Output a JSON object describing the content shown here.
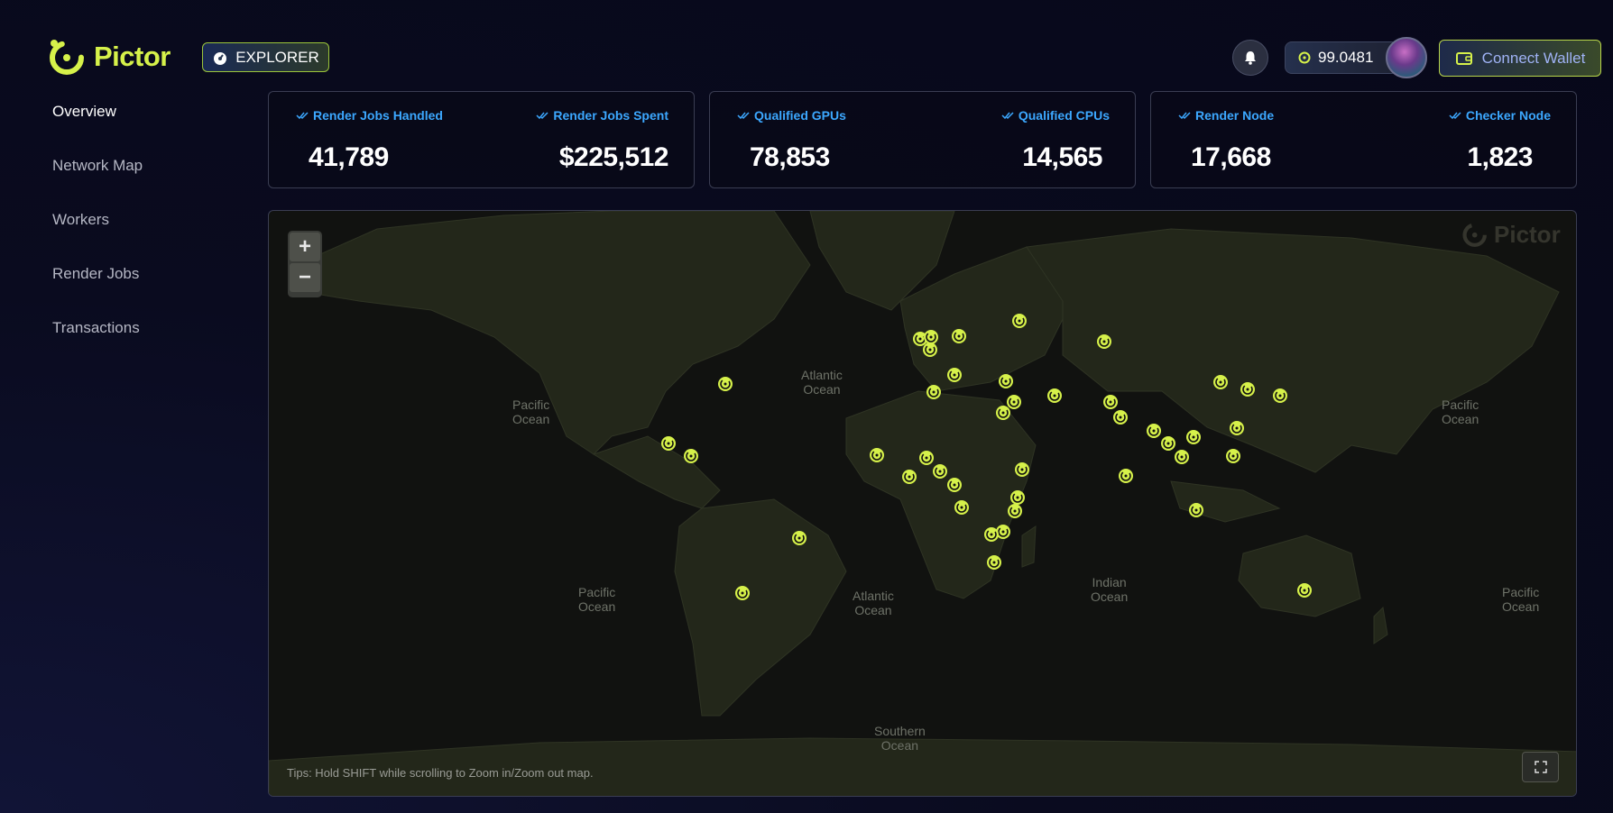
{
  "brand": {
    "name": "Pictor",
    "logo_icon": "pictor-logo-icon",
    "accent": "#d6f14a"
  },
  "header": {
    "explorer_label": "EXPLORER",
    "balance": "99.0481",
    "connect_label": "Connect Wallet"
  },
  "nav": {
    "items": [
      {
        "label": "Overview",
        "active": true
      },
      {
        "label": "Network Map",
        "active": false
      },
      {
        "label": "Workers",
        "active": false
      },
      {
        "label": "Render Jobs",
        "active": false
      },
      {
        "label": "Transactions",
        "active": false
      }
    ]
  },
  "stats": [
    {
      "left_label": "Render Jobs Handled",
      "left_value": "41,789",
      "right_label": "Render Jobs Spent",
      "right_value": "$225,512"
    },
    {
      "left_label": "Qualified GPUs",
      "left_value": "78,853",
      "right_label": "Qualified CPUs",
      "right_value": "14,565"
    },
    {
      "left_label": "Render Node",
      "left_value": "17,668",
      "right_label": "Checker Node",
      "right_value": "1,823"
    }
  ],
  "map": {
    "zoom_in": "+",
    "zoom_out": "−",
    "watermark": "Pictor",
    "oceans": [
      "Pacific\nOcean",
      "Atlantic\nOcean",
      "Pacific\nOcean",
      "Atlantic\nOcean",
      "Indian\nOcean",
      "Pacific\nOcean",
      "Pacific\nOcean",
      "Southern\nOcean"
    ],
    "tips": "Tips: Hold SHIFT while scrolling to Zoom in/Zoom out map."
  },
  "colors": {
    "stat_label": "#3ca8ff",
    "marker": "#d6f14a",
    "card_border": "#3a3d52"
  }
}
